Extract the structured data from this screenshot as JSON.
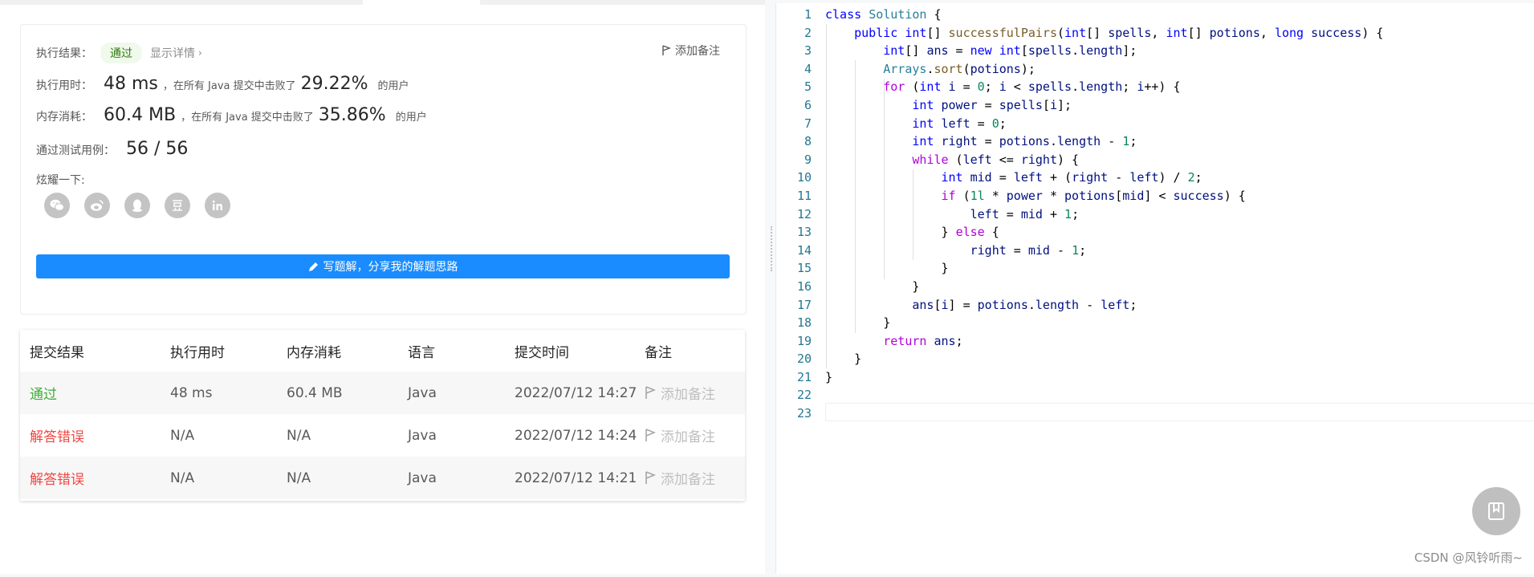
{
  "result": {
    "status_label": "执行结果：",
    "status_value": "通过",
    "detail_link": "显示详情",
    "add_note": "添加备注",
    "runtime_label": "执行用时：",
    "runtime_value": "48 ms",
    "runtime_text": "，在所有 Java 提交中击败了",
    "runtime_pct": "29.22%",
    "runtime_suffix": "的用户",
    "memory_label": "内存消耗：",
    "memory_value": "60.4 MB",
    "memory_text": "，在所有 Java 提交中击败了",
    "memory_pct": "35.86%",
    "memory_suffix": "的用户",
    "tests_label": "通过测试用例：",
    "tests_value": "56 / 56",
    "share_label": "炫耀一下:",
    "share_icons": [
      "wechat-icon",
      "weibo-icon",
      "qq-icon",
      "douban-icon",
      "linkedin-icon"
    ],
    "write_button": "写题解，分享我的解题思路"
  },
  "submissions": {
    "headers": [
      "提交结果",
      "执行用时",
      "内存消耗",
      "语言",
      "提交时间",
      "备注"
    ],
    "rows": [
      {
        "status": "通过",
        "runtime": "48 ms",
        "memory": "60.4 MB",
        "lang": "Java",
        "time": "2022/07/12 14:27",
        "note": "添加备注"
      },
      {
        "status": "解答错误",
        "runtime": "N/A",
        "memory": "N/A",
        "lang": "Java",
        "time": "2022/07/12 14:24",
        "note": "添加备注"
      },
      {
        "status": "解答错误",
        "runtime": "N/A",
        "memory": "N/A",
        "lang": "Java",
        "time": "2022/07/12 14:21",
        "note": "添加备注"
      }
    ]
  },
  "colors": {
    "accent": "#1a8cff",
    "pass": "#3fad3a",
    "error": "#ef4743"
  },
  "editor": {
    "lines": [
      {
        "n": "1",
        "tokens": [
          [
            "kw",
            "class"
          ],
          [
            "plain",
            " "
          ],
          [
            "ty",
            "Solution"
          ],
          [
            "plain",
            " {"
          ]
        ]
      },
      {
        "n": "2",
        "tokens": [
          [
            "plain",
            "    "
          ],
          [
            "kw",
            "public"
          ],
          [
            "plain",
            " "
          ],
          [
            "kw",
            "int"
          ],
          [
            "plain",
            "[] "
          ],
          [
            "fn",
            "successfulPairs"
          ],
          [
            "plain",
            "("
          ],
          [
            "kw",
            "int"
          ],
          [
            "plain",
            "[] "
          ],
          [
            "var",
            "spells"
          ],
          [
            "plain",
            ", "
          ],
          [
            "kw",
            "int"
          ],
          [
            "plain",
            "[] "
          ],
          [
            "var",
            "potions"
          ],
          [
            "plain",
            ", "
          ],
          [
            "kw",
            "long"
          ],
          [
            "plain",
            " "
          ],
          [
            "var",
            "success"
          ],
          [
            "plain",
            ") {"
          ]
        ]
      },
      {
        "n": "3",
        "tokens": [
          [
            "plain",
            "        "
          ],
          [
            "kw",
            "int"
          ],
          [
            "plain",
            "[] "
          ],
          [
            "var",
            "ans"
          ],
          [
            "plain",
            " = "
          ],
          [
            "kw",
            "new"
          ],
          [
            "plain",
            " "
          ],
          [
            "kw",
            "int"
          ],
          [
            "plain",
            "["
          ],
          [
            "var",
            "spells"
          ],
          [
            "plain",
            "."
          ],
          [
            "var",
            "length"
          ],
          [
            "plain",
            "];"
          ]
        ]
      },
      {
        "n": "4",
        "tokens": [
          [
            "plain",
            "        "
          ],
          [
            "ty",
            "Arrays"
          ],
          [
            "plain",
            "."
          ],
          [
            "fn",
            "sort"
          ],
          [
            "plain",
            "("
          ],
          [
            "var",
            "potions"
          ],
          [
            "plain",
            ");"
          ]
        ]
      },
      {
        "n": "5",
        "tokens": [
          [
            "plain",
            "        "
          ],
          [
            "kw2",
            "for"
          ],
          [
            "plain",
            " ("
          ],
          [
            "kw",
            "int"
          ],
          [
            "plain",
            " "
          ],
          [
            "var",
            "i"
          ],
          [
            "plain",
            " = "
          ],
          [
            "num",
            "0"
          ],
          [
            "plain",
            "; "
          ],
          [
            "var",
            "i"
          ],
          [
            "plain",
            " < "
          ],
          [
            "var",
            "spells"
          ],
          [
            "plain",
            "."
          ],
          [
            "var",
            "length"
          ],
          [
            "plain",
            "; "
          ],
          [
            "var",
            "i"
          ],
          [
            "plain",
            "++) {"
          ]
        ]
      },
      {
        "n": "6",
        "tokens": [
          [
            "plain",
            "            "
          ],
          [
            "kw",
            "int"
          ],
          [
            "plain",
            " "
          ],
          [
            "var",
            "power"
          ],
          [
            "plain",
            " = "
          ],
          [
            "var",
            "spells"
          ],
          [
            "plain",
            "["
          ],
          [
            "var",
            "i"
          ],
          [
            "plain",
            "];"
          ]
        ]
      },
      {
        "n": "7",
        "tokens": [
          [
            "plain",
            "            "
          ],
          [
            "kw",
            "int"
          ],
          [
            "plain",
            " "
          ],
          [
            "var",
            "left"
          ],
          [
            "plain",
            " = "
          ],
          [
            "num",
            "0"
          ],
          [
            "plain",
            ";"
          ]
        ]
      },
      {
        "n": "8",
        "tokens": [
          [
            "plain",
            "            "
          ],
          [
            "kw",
            "int"
          ],
          [
            "plain",
            " "
          ],
          [
            "var",
            "right"
          ],
          [
            "plain",
            " = "
          ],
          [
            "var",
            "potions"
          ],
          [
            "plain",
            "."
          ],
          [
            "var",
            "length"
          ],
          [
            "plain",
            " - "
          ],
          [
            "num",
            "1"
          ],
          [
            "plain",
            ";"
          ]
        ]
      },
      {
        "n": "9",
        "tokens": [
          [
            "plain",
            "            "
          ],
          [
            "kw2",
            "while"
          ],
          [
            "plain",
            " ("
          ],
          [
            "var",
            "left"
          ],
          [
            "plain",
            " <= "
          ],
          [
            "var",
            "right"
          ],
          [
            "plain",
            ") {"
          ]
        ]
      },
      {
        "n": "10",
        "tokens": [
          [
            "plain",
            "                "
          ],
          [
            "kw",
            "int"
          ],
          [
            "plain",
            " "
          ],
          [
            "var",
            "mid"
          ],
          [
            "plain",
            " = "
          ],
          [
            "var",
            "left"
          ],
          [
            "plain",
            " + ("
          ],
          [
            "var",
            "right"
          ],
          [
            "plain",
            " - "
          ],
          [
            "var",
            "left"
          ],
          [
            "plain",
            ") / "
          ],
          [
            "num",
            "2"
          ],
          [
            "plain",
            ";"
          ]
        ]
      },
      {
        "n": "11",
        "tokens": [
          [
            "plain",
            "                "
          ],
          [
            "kw2",
            "if"
          ],
          [
            "plain",
            " ("
          ],
          [
            "num",
            "1l"
          ],
          [
            "plain",
            " * "
          ],
          [
            "var",
            "power"
          ],
          [
            "plain",
            " * "
          ],
          [
            "var",
            "potions"
          ],
          [
            "plain",
            "["
          ],
          [
            "var",
            "mid"
          ],
          [
            "plain",
            "] < "
          ],
          [
            "var",
            "success"
          ],
          [
            "plain",
            ") {"
          ]
        ]
      },
      {
        "n": "12",
        "tokens": [
          [
            "plain",
            "                    "
          ],
          [
            "var",
            "left"
          ],
          [
            "plain",
            " = "
          ],
          [
            "var",
            "mid"
          ],
          [
            "plain",
            " + "
          ],
          [
            "num",
            "1"
          ],
          [
            "plain",
            ";"
          ]
        ]
      },
      {
        "n": "13",
        "tokens": [
          [
            "plain",
            "                } "
          ],
          [
            "kw2",
            "else"
          ],
          [
            "plain",
            " {"
          ]
        ]
      },
      {
        "n": "14",
        "tokens": [
          [
            "plain",
            "                    "
          ],
          [
            "var",
            "right"
          ],
          [
            "plain",
            " = "
          ],
          [
            "var",
            "mid"
          ],
          [
            "plain",
            " - "
          ],
          [
            "num",
            "1"
          ],
          [
            "plain",
            ";"
          ]
        ]
      },
      {
        "n": "15",
        "tokens": [
          [
            "plain",
            "                }"
          ]
        ]
      },
      {
        "n": "16",
        "tokens": [
          [
            "plain",
            "            }"
          ]
        ]
      },
      {
        "n": "17",
        "tokens": [
          [
            "plain",
            "            "
          ],
          [
            "var",
            "ans"
          ],
          [
            "plain",
            "["
          ],
          [
            "var",
            "i"
          ],
          [
            "plain",
            "] = "
          ],
          [
            "var",
            "potions"
          ],
          [
            "plain",
            "."
          ],
          [
            "var",
            "length"
          ],
          [
            "plain",
            " - "
          ],
          [
            "var",
            "left"
          ],
          [
            "plain",
            ";"
          ]
        ]
      },
      {
        "n": "18",
        "tokens": [
          [
            "plain",
            "        }"
          ]
        ]
      },
      {
        "n": "19",
        "tokens": [
          [
            "plain",
            "        "
          ],
          [
            "kw2",
            "return"
          ],
          [
            "plain",
            " "
          ],
          [
            "var",
            "ans"
          ],
          [
            "plain",
            ";"
          ]
        ]
      },
      {
        "n": "20",
        "tokens": [
          [
            "plain",
            "    }"
          ]
        ]
      },
      {
        "n": "21",
        "tokens": [
          [
            "plain",
            "}"
          ]
        ]
      },
      {
        "n": "22",
        "tokens": []
      },
      {
        "n": "23",
        "tokens": []
      }
    ]
  },
  "watermark": "CSDN @风铃听雨~"
}
